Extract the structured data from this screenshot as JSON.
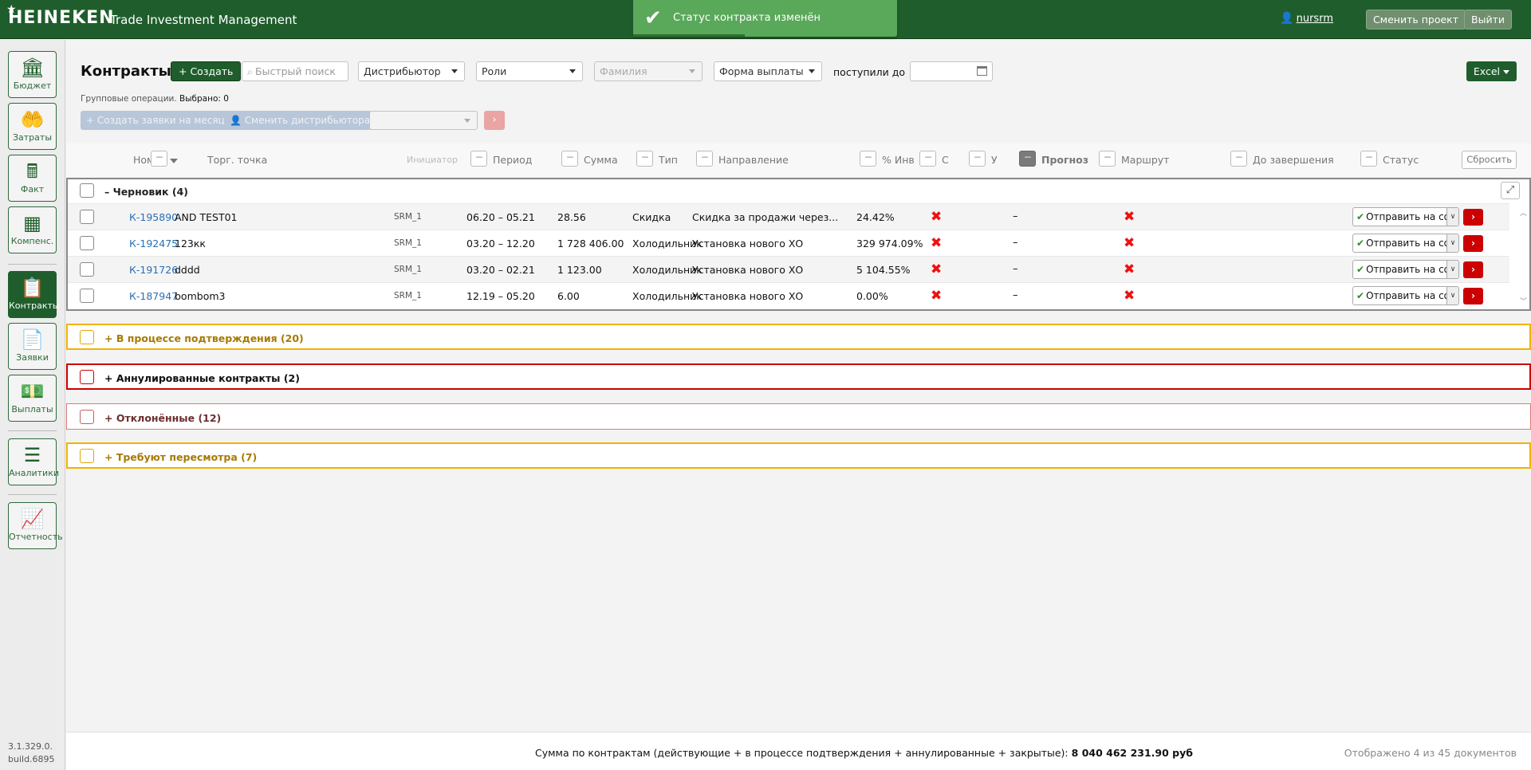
{
  "header": {
    "logo": "HEINEKEN",
    "app_title": "Trade Investment Management",
    "user": "nursrm",
    "change_project": "Сменить проект",
    "logout": "Выйти"
  },
  "toast": {
    "message": "Статус контракта изменён",
    "progress": 0.42
  },
  "sidebar": {
    "items": [
      {
        "label": "Бюджет",
        "icon": "bank-icon"
      },
      {
        "label": "Затраты",
        "icon": "coins-hand-icon"
      },
      {
        "label": "Факт",
        "icon": "cash-register-icon"
      },
      {
        "label": "Компенс.",
        "icon": "calculator-icon"
      },
      {
        "label": "Контракты",
        "icon": "contract-icon",
        "active": true
      },
      {
        "label": "Заявки",
        "icon": "document-list-icon"
      },
      {
        "label": "Выплаты",
        "icon": "money-icon"
      },
      {
        "label": "Аналитики",
        "icon": "list-icon"
      },
      {
        "label": "Отчетность",
        "icon": "chart-search-icon"
      }
    ],
    "version": "3.1.329.0.",
    "build": "build.6895"
  },
  "toolbar": {
    "title": "Контракты",
    "create": "+ Создать",
    "search_placeholder": "Быстрый поиск",
    "distributor": "Дистрибьютор",
    "roles": "Роли",
    "surname": "Фамилия",
    "payment_form": "Форма выплаты",
    "received_until": "поступили до",
    "excel": "Excel",
    "group_ops_label": "Групповые операции.",
    "selected": "Выбрано: 0",
    "create_requests": "+ Создать заявки на месяц",
    "change_distributor": "Сменить дистрибьютора",
    "go": "›"
  },
  "columns": {
    "number": "Номер",
    "point": "Торг. точка",
    "initiator": "Инициатор",
    "period": "Период",
    "sum": "Сумма",
    "type": "Тип",
    "direction": "Направление",
    "inv": "% Инв",
    "c": "С",
    "u": "У",
    "forecast": "Прогноз",
    "route": "Маршрут",
    "until_end": "До завершения",
    "status": "Статус",
    "reset": "Сбросить",
    "filter_dots": "---"
  },
  "groups": {
    "draft": {
      "title": "– Черновик (4)",
      "rows": [
        {
          "number": "К-195890",
          "point": "AND TEST01",
          "initiator": "SRM_1",
          "period": "06.20 – 05.21",
          "sum": "28.56",
          "type": "Скидка",
          "direction": "Скидка за продажи через...",
          "inv": "24.42%",
          "u": "–",
          "status": "Отправить на согл."
        },
        {
          "number": "К-192475",
          "point": "123кк",
          "initiator": "SRM_1",
          "period": "03.20 – 12.20",
          "sum": "1 728 406.00",
          "type": "Холодильник",
          "direction": "Установка нового ХО",
          "inv": "329 974.09%",
          "u": "–",
          "status": "Отправить на согл."
        },
        {
          "number": "К-191726",
          "point": "dddd",
          "initiator": "SRM_1",
          "period": "03.20 – 02.21",
          "sum": "1 123.00",
          "type": "Холодильник",
          "direction": "Установка нового ХО",
          "inv": "5 104.55%",
          "u": "–",
          "status": "Отправить на согл."
        },
        {
          "number": "К-187947",
          "point": "bombom3",
          "initiator": "SRM_1",
          "period": "12.19 – 05.20",
          "sum": "6.00",
          "type": "Холодильник",
          "direction": "Установка нового ХО",
          "inv": "0.00%",
          "u": "–",
          "status": "Отправить на согл."
        }
      ]
    },
    "pending": "+ В процессе подтверждения (20)",
    "cancelled": "+ Аннулированные контракты (2)",
    "rejected": "+ Отклонённые (12)",
    "review": "+ Требуют пересмотра (7)"
  },
  "footer": {
    "sum_label": "Сумма по контрактам (действующие + в процессе подтверждения + аннулированные + закрытые):",
    "sum_value": "8 040 462 231.90 руб",
    "count": "Отображено 4 из 45 документов"
  },
  "colors": {
    "brand": "#1f5e2c",
    "danger": "#cc0000",
    "warning": "#f0b400",
    "link": "#2a6fb4"
  }
}
